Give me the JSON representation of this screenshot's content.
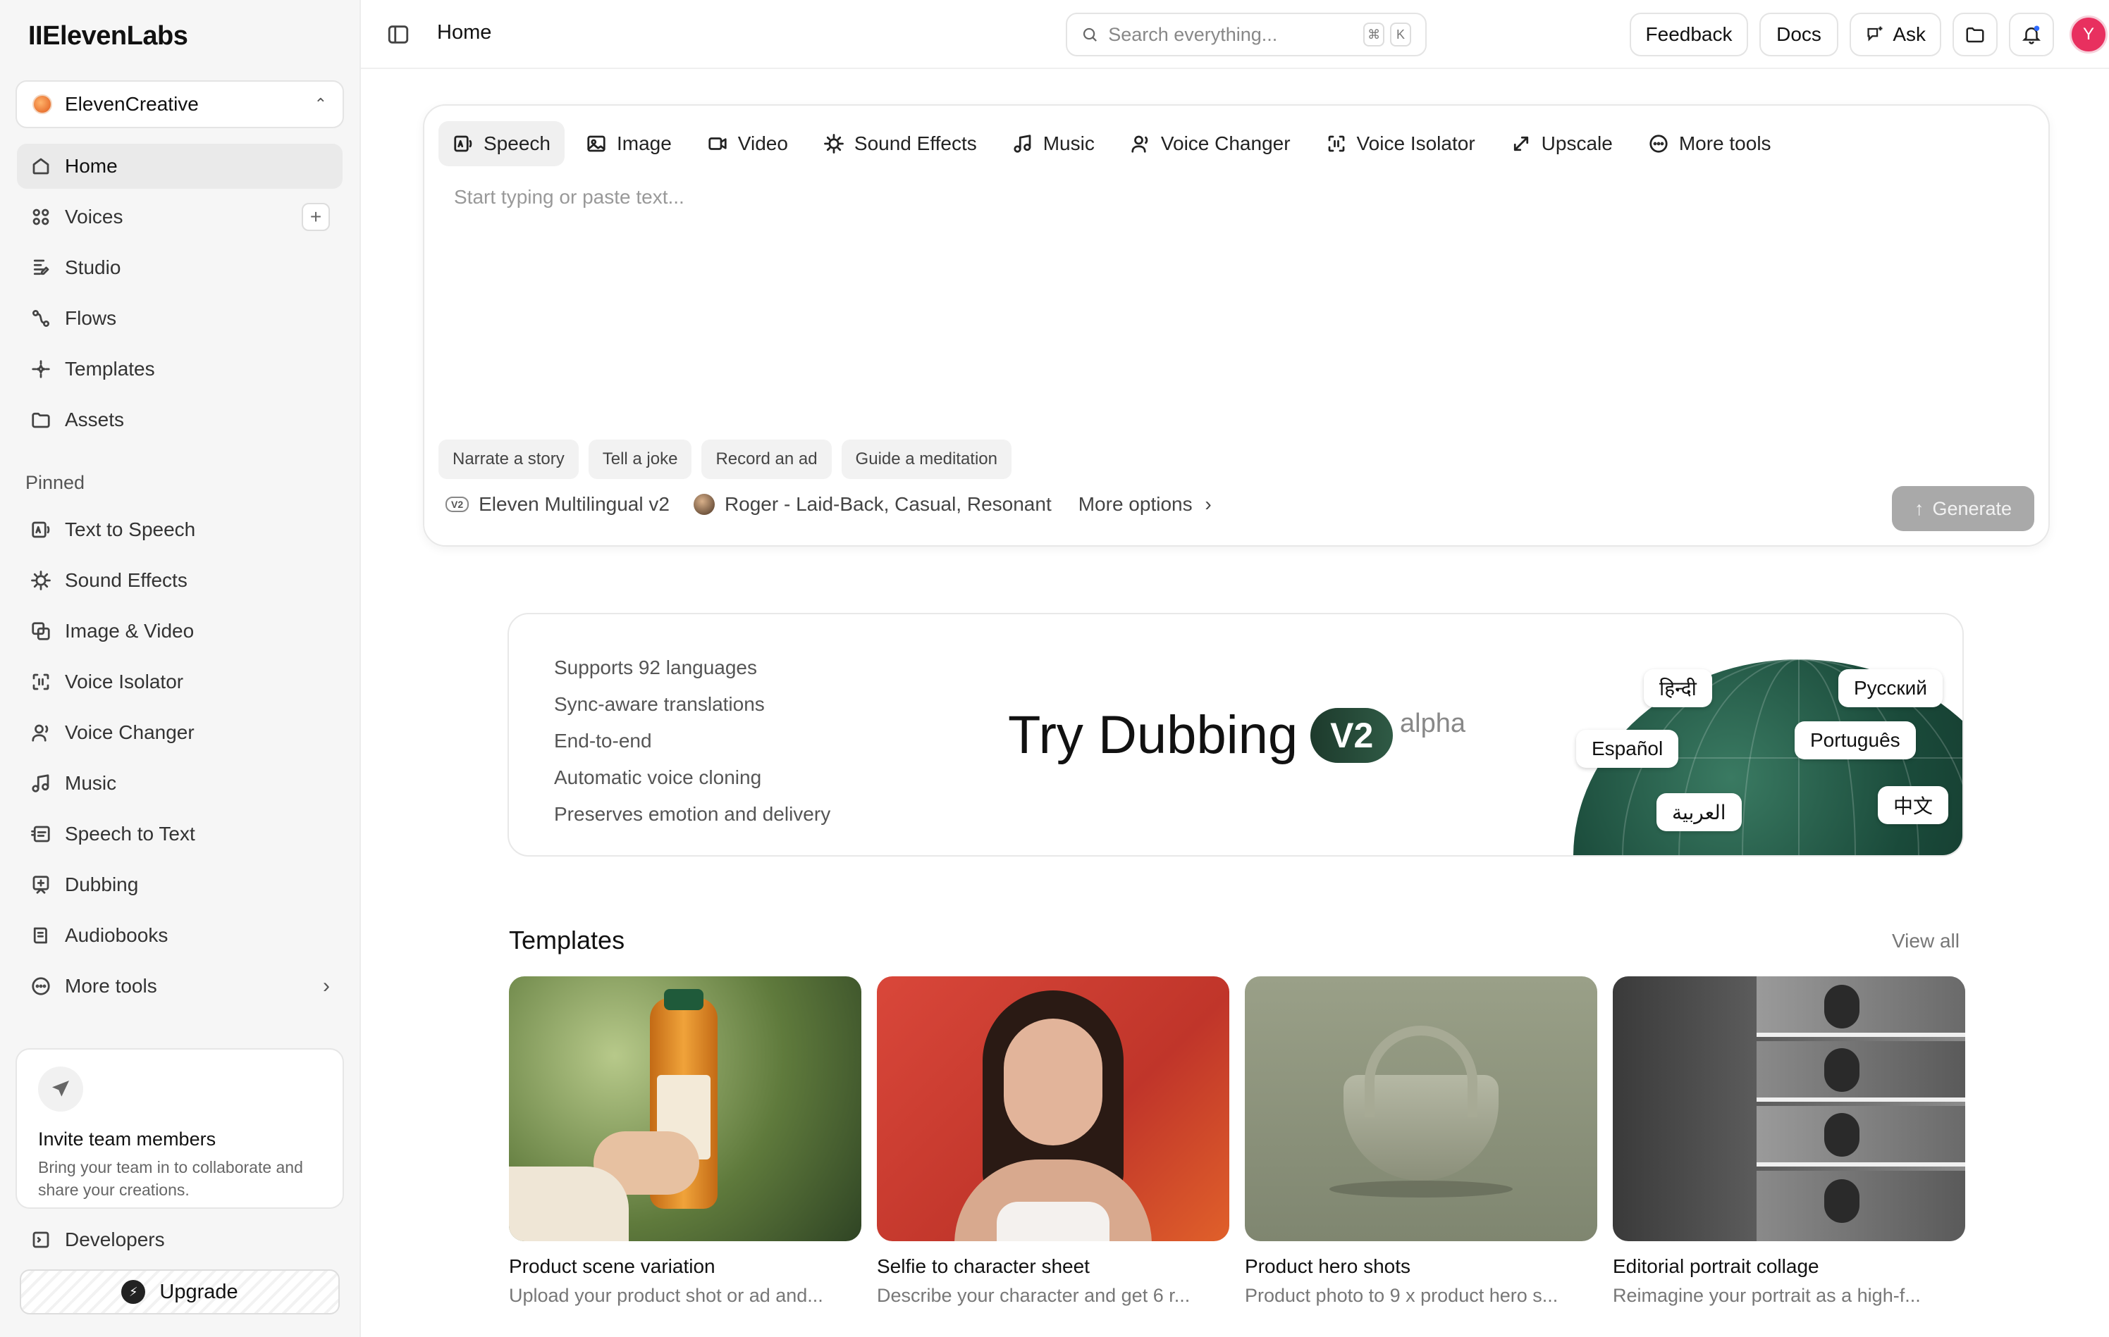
{
  "brand": "IIElevenLabs",
  "workspace": {
    "name": "ElevenCreative"
  },
  "nav": {
    "home": "Home",
    "voices": "Voices",
    "studio": "Studio",
    "flows": "Flows",
    "templates": "Templates",
    "assets": "Assets"
  },
  "pinned": {
    "label": "Pinned",
    "items": [
      "Text to Speech",
      "Sound Effects",
      "Image & Video",
      "Voice Isolator",
      "Voice Changer",
      "Music",
      "Speech to Text",
      "Dubbing",
      "Audiobooks",
      "More tools"
    ]
  },
  "invite": {
    "title": "Invite team members",
    "desc": "Bring your team in to collaborate and share your creations."
  },
  "developers": "Developers",
  "upgrade": "Upgrade",
  "topbar": {
    "breadcrumb": "Home",
    "search_placeholder": "Search everything...",
    "kbd_cmd": "⌘",
    "kbd_k": "K",
    "feedback": "Feedback",
    "docs": "Docs",
    "ask": "Ask",
    "avatar_initial": "Y"
  },
  "composer": {
    "tabs": [
      "Speech",
      "Image",
      "Video",
      "Sound Effects",
      "Music",
      "Voice Changer",
      "Voice Isolator",
      "Upscale",
      "More tools"
    ],
    "placeholder": "Start typing or paste text...",
    "chips": [
      "Narrate a story",
      "Tell a joke",
      "Record an ad",
      "Guide a meditation"
    ],
    "model_badge": "V2",
    "model": "Eleven Multilingual v2",
    "voice": "Roger - Laid-Back, Casual, Resonant",
    "more_options": "More options",
    "generate": "Generate"
  },
  "banner": {
    "features": [
      "Supports 92 languages",
      "Sync-aware translations",
      "End-to-end",
      "Automatic voice cloning",
      "Preserves emotion and delivery"
    ],
    "title": "Try Dubbing",
    "badge": "V2",
    "tag": "alpha",
    "languages": [
      "हिन्दी",
      "Русский",
      "Español",
      "Português",
      "العربية",
      "中文"
    ]
  },
  "templates": {
    "title": "Templates",
    "view_all": "View all",
    "cards": [
      {
        "title": "Product scene variation",
        "desc": "Upload your product shot or ad and..."
      },
      {
        "title": "Selfie to character sheet",
        "desc": "Describe your character and get 6 r..."
      },
      {
        "title": "Product hero shots",
        "desc": "Product photo to 9 x product hero s..."
      },
      {
        "title": "Editorial portrait collage",
        "desc": "Reimagine your portrait as a high-f..."
      }
    ]
  },
  "colors": {
    "avatar": "#e8305f",
    "generate_disabled": "#a9a9a9",
    "globe": "#1a4a3a"
  }
}
